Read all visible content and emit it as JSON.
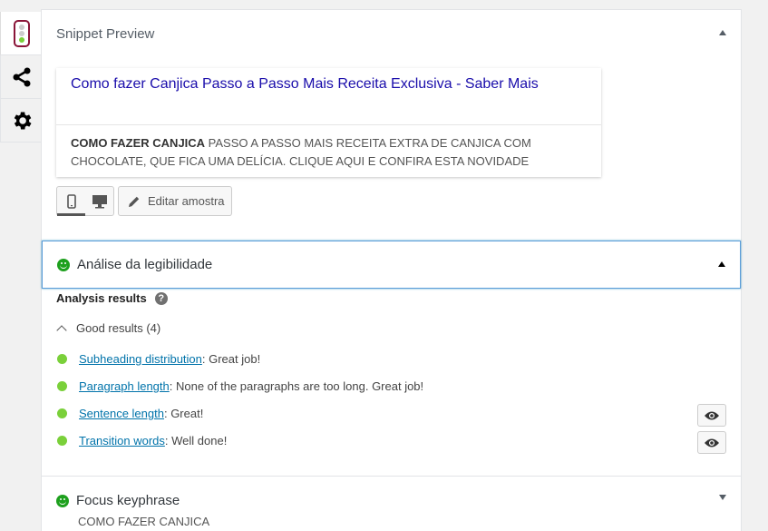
{
  "sidebar": {
    "tabs": [
      {
        "icon": "traffic-light-icon"
      },
      {
        "icon": "share-icon"
      },
      {
        "icon": "gear-icon"
      }
    ]
  },
  "snippet_section": {
    "title": "Snippet Preview",
    "snippet": {
      "title": "Como fazer Canjica Passo a Passo Mais Receita Exclusiva - Saber Mais",
      "desc_bold": "COMO FAZER CANJICA",
      "desc_rest": " PASSO A PASSO MAIS RECEITA EXTRA DE CANJICA COM CHOCOLATE, QUE FICA UMA DELÍCIA. CLIQUE AQUI E CONFIRA ESTA NOVIDADE"
    },
    "edit_label": "Editar amostra"
  },
  "readability": {
    "title": "Análise da legibilidade",
    "results_title": "Analysis results",
    "help": "?",
    "good_results": "Good results (4)",
    "items": [
      {
        "link": "Subheading distribution",
        "text": ": Great job!"
      },
      {
        "link": "Paragraph length",
        "text": ": None of the paragraphs are too long. Great job!"
      },
      {
        "link": "Sentence length",
        "text": ": Great!"
      },
      {
        "link": "Transition words",
        "text": ": Well done!"
      }
    ]
  },
  "focus": {
    "title": "Focus keyphrase",
    "value": "COMO FAZER CANJICA"
  },
  "colors": {
    "good": "#1ea01e",
    "bullet": "#7ad03a",
    "link": "#0073aa",
    "snippet_title": "#1a0dab",
    "focus_border": "#5b9dd9"
  }
}
